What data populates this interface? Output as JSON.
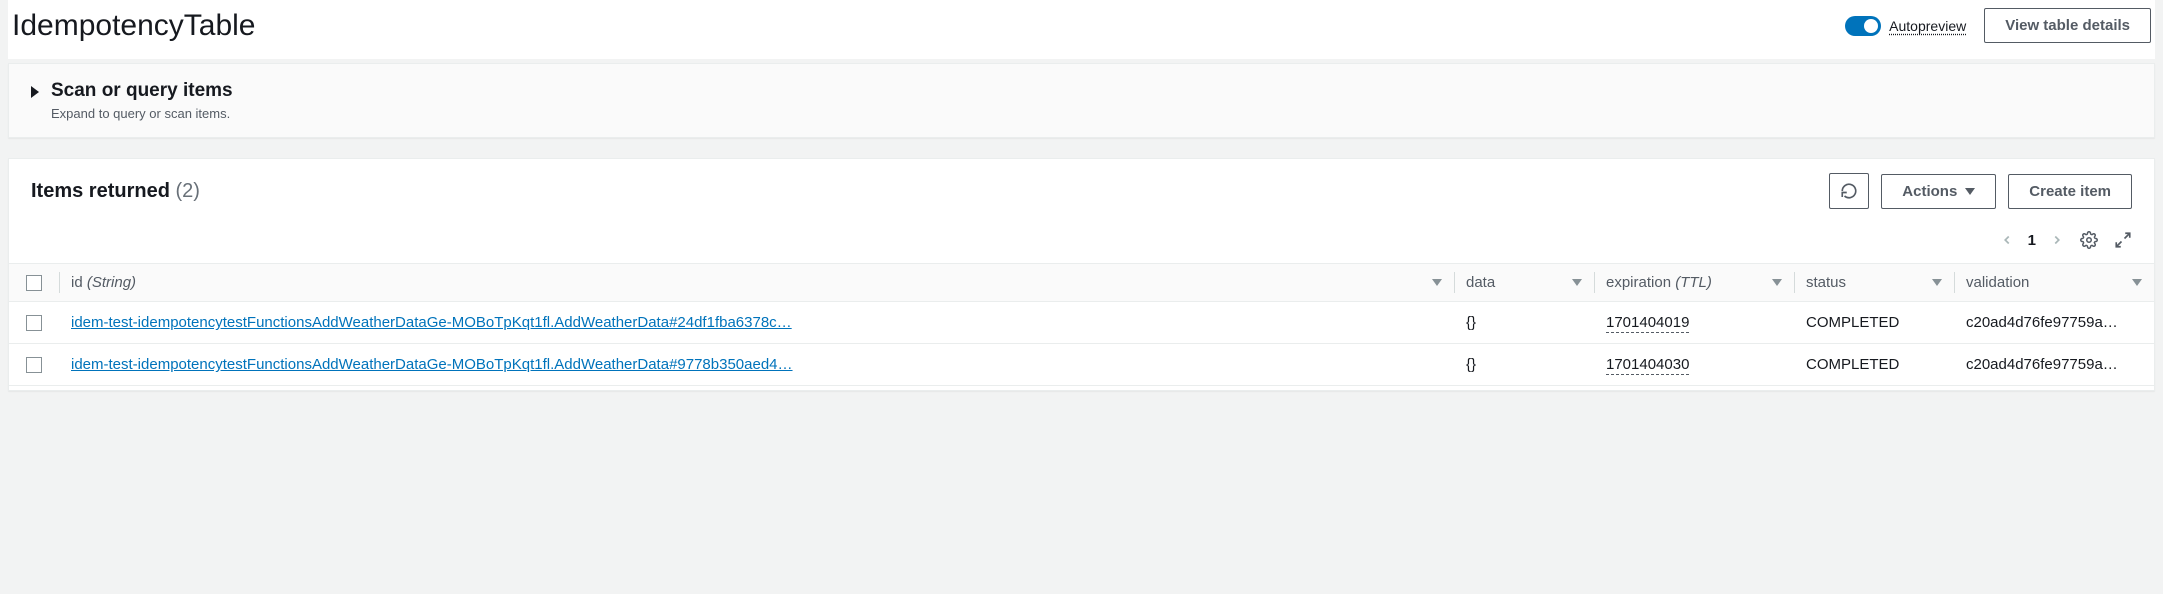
{
  "header": {
    "title": "IdempotencyTable",
    "autopreview_label": "Autopreview",
    "view_details_label": "View table details"
  },
  "scan_panel": {
    "title": "Scan or query items",
    "subtitle": "Expand to query or scan items."
  },
  "items": {
    "title": "Items returned",
    "count_display": "(2)",
    "actions_label": "Actions",
    "create_label": "Create item",
    "page": "1"
  },
  "columns": {
    "id": {
      "label": "id",
      "type": "(String)"
    },
    "data": {
      "label": "data"
    },
    "expiration": {
      "label": "expiration",
      "type": "(TTL)"
    },
    "status": {
      "label": "status"
    },
    "validation": {
      "label": "validation"
    }
  },
  "rows": [
    {
      "id": "idem-test-idempotencytestFunctionsAddWeatherDataGe-MOBoTpKqt1fl.AddWeatherData#24df1fba6378c…",
      "data": "{}",
      "expiration": "1701404019",
      "status": "COMPLETED",
      "validation": "c20ad4d76fe97759a…"
    },
    {
      "id": "idem-test-idempotencytestFunctionsAddWeatherDataGe-MOBoTpKqt1fl.AddWeatherData#9778b350aed4…",
      "data": "{}",
      "expiration": "1701404030",
      "status": "COMPLETED",
      "validation": "c20ad4d76fe97759a…"
    }
  ]
}
